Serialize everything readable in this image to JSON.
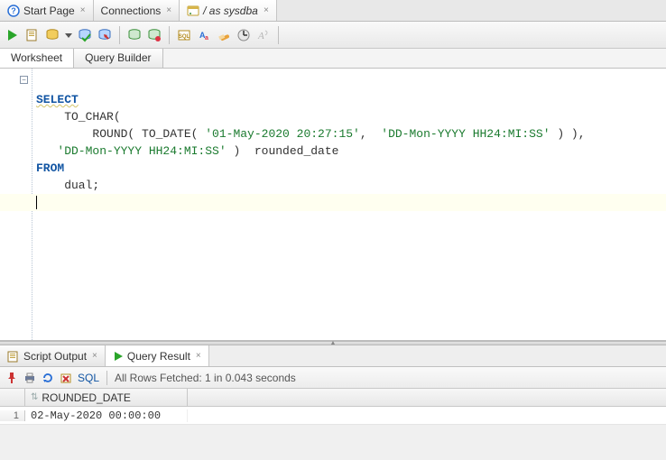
{
  "topTabs": [
    {
      "label": "Start Page"
    },
    {
      "label": "Connections"
    },
    {
      "label": "/ as sysdba",
      "active": true
    }
  ],
  "subTabs": {
    "worksheet": "Worksheet",
    "queryBuilder": "Query Builder"
  },
  "code": {
    "l1_kw": "SELECT",
    "l2": "    TO_CHAR(",
    "l3a": "        ROUND( TO_DATE( ",
    "l3s1": "'01-May-2020 20:27:15'",
    "l3c1": ",  ",
    "l3s2": "'DD-Mon-YYYY HH24:MI:SS'",
    "l3b": " ) ),",
    "l4s": "   'DD-Mon-YYYY HH24:MI:SS'",
    "l4b": " )  rounded_date",
    "l5_kw": "FROM",
    "l6": "    dual;"
  },
  "resultTabs": {
    "scriptOutput": "Script Output",
    "queryResult": "Query Result"
  },
  "resultToolbar": {
    "sqlLabel": "SQL",
    "status": "All Rows Fetched: 1 in 0.043 seconds"
  },
  "grid": {
    "column": "ROUNDED_DATE",
    "rownum": "1",
    "value": "02-May-2020 00:00:00"
  }
}
